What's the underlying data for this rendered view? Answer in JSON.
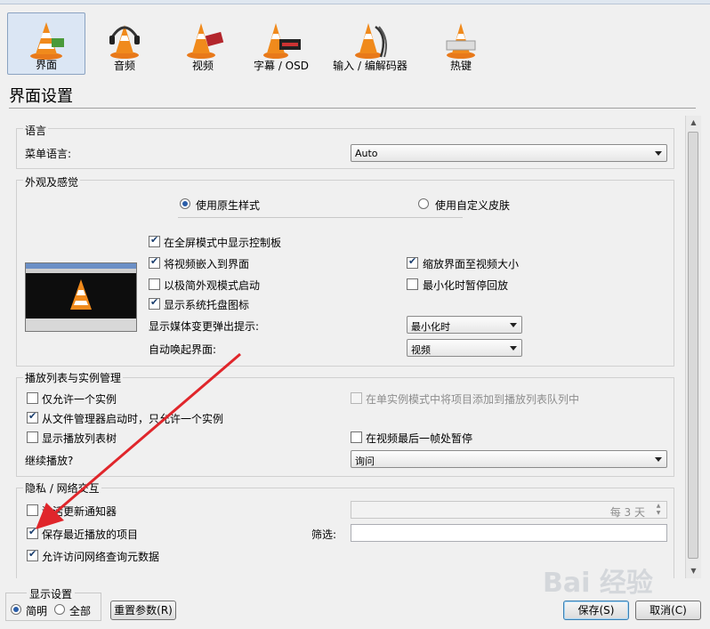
{
  "categories": [
    {
      "label": "界面",
      "icon": "vlc-cone-interface-icon",
      "selected": true
    },
    {
      "label": "音频",
      "icon": "vlc-cone-headphones-icon",
      "selected": false
    },
    {
      "label": "视频",
      "icon": "vlc-cone-film-icon",
      "selected": false
    },
    {
      "label": "字幕 / OSD",
      "icon": "vlc-cone-subtitle-icon",
      "selected": false
    },
    {
      "label": "输入 / 编解码器",
      "icon": "vlc-cone-cable-icon",
      "selected": false
    },
    {
      "label": "热键",
      "icon": "vlc-cone-keyboard-icon",
      "selected": false
    }
  ],
  "page_title": "界面设置",
  "language": {
    "title": "语言",
    "menu_language_label": "菜单语言:",
    "menu_language_value": "Auto"
  },
  "look": {
    "title": "外观及感觉",
    "native_style": "使用原生样式",
    "custom_skin": "使用自定义皮肤",
    "fullscreen_controls": "在全屏模式中显示控制板",
    "embed_video": "将视频嵌入到界面",
    "resize_to_video": "缩放界面至视频大小",
    "minimal_mode": "以极简外观模式启动",
    "pause_minimized": "最小化时暂停回放",
    "systray": "显示系统托盘图标",
    "popup_label": "显示媒体变更弹出提示:",
    "popup_value": "最小化时",
    "raise_label": "自动唤起界面:",
    "raise_value": "视频"
  },
  "playlist": {
    "title": "播放列表与实例管理",
    "one_instance": "仅允许一个实例",
    "enqueue_one_instance": "在单实例模式中将项目添加到播放列表队列中",
    "one_instance_from_fm": "从文件管理器启动时，只允许一个实例",
    "playlist_tree": "显示播放列表树",
    "pause_last_frame": "在视频最后一帧处暂停",
    "continue_label": "继续播放?",
    "continue_value": "询问"
  },
  "privacy": {
    "title": "隐私 / 网络交互",
    "update_notifier": "激活更新通知器",
    "update_every": "每 3 天",
    "save_recent": "保存最近播放的项目",
    "filter_label": "筛选:",
    "filter_value": "",
    "metadata_access": "允许访问网络查询元数据"
  },
  "footer": {
    "show_settings": "显示设置",
    "simple": "简明",
    "all": "全部",
    "reset": "重置参数(R)",
    "save": "保存(S)",
    "cancel": "取消(C)"
  },
  "watermark": "Bai 经验",
  "colors": {
    "arrow": "#e0262b",
    "selection_bg": "#dbe6f4"
  }
}
